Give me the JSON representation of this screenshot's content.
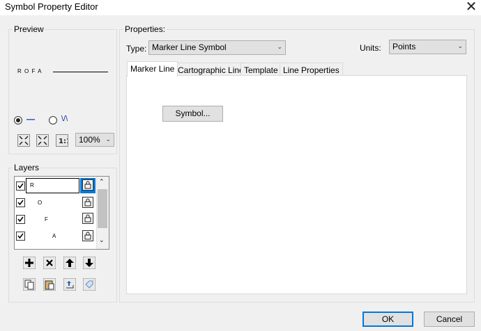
{
  "window": {
    "title": "Symbol Property Editor",
    "close_glyph": "✕"
  },
  "preview": {
    "group_label": "Preview",
    "sample_text": "R O F A",
    "radio_line_selected": true,
    "radio_line_label": "—",
    "radio_other_label": "\\/\\",
    "zoom": {
      "value": "100%",
      "options": [
        "100%"
      ]
    }
  },
  "layers": {
    "group_label": "Layers",
    "items": [
      {
        "label": "R",
        "checked": true,
        "selected": true,
        "lock_icon": "lock-icon"
      },
      {
        "label": "O",
        "checked": true,
        "selected": false,
        "lock_icon": "lock-icon"
      },
      {
        "label": "F",
        "checked": true,
        "selected": false,
        "lock_icon": "lock-icon"
      },
      {
        "label": "A",
        "checked": true,
        "selected": false,
        "lock_icon": "lock-icon"
      }
    ],
    "actions": [
      "add-icon",
      "delete-icon",
      "move-up-icon",
      "move-down-icon"
    ],
    "actions2": [
      "copy-icon",
      "paste-icon",
      "load-icon",
      "tag-icon"
    ]
  },
  "properties": {
    "group_label": "Properties:",
    "type_label": "Type:",
    "type_value": "Marker Line Symbol",
    "units_label": "Units:",
    "units_value": "Points",
    "tabs": [
      "Marker Line",
      "Cartographic Line",
      "Template",
      "Line Properties"
    ],
    "active_tab": "Marker Line",
    "symbol_button": "Symbol..."
  },
  "footer": {
    "ok": "OK",
    "cancel": "Cancel"
  },
  "colors": {
    "accent": "#0078d7",
    "selection": "#0078d7"
  }
}
